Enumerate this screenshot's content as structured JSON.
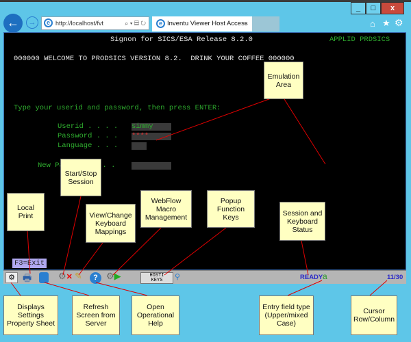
{
  "browser": {
    "address": "http://localhost/fvt",
    "tab_title": "Inventu Viewer Host Access",
    "tab_close": "×",
    "window_buttons": [
      "minimize",
      "maximize",
      "close"
    ]
  },
  "terminal": {
    "header": "Signon for SICS/ESA Release 8.2.0",
    "applid": "APPLID PRDSICS",
    "welcome": "000000 WELCOME TO PRODSICS VERSION 8.2.  DRINK YOUR COFFEE 000000",
    "instruction": "Type your userid and password, then press ENTER:",
    "userid_label": "Userid . . . .",
    "userid_value": "simmy",
    "password_label": "Password . . .",
    "password_value": "****",
    "language_label": "Language . . .",
    "new_password_label": "New Password . . .",
    "f3": "F3=Exit"
  },
  "statusbar": {
    "host_keys_top": "HOSTI",
    "host_keys_bottom": "KEYS",
    "status": "READY",
    "entry_type": "a",
    "cursor": "11/30"
  },
  "callouts": {
    "emulation": "Emulation Area",
    "startstop": "Start/Stop Session",
    "print": "Local Print",
    "keyboard": "View/Change Keyboard Mappings",
    "webflow": "WebFlow Macro Management",
    "popup": "Popup Function Keys",
    "session": "Session and Keyboard Status",
    "settings": "Displays Settings Property Sheet",
    "refresh": "Refresh Screen from Server",
    "help": "Open Operational Help",
    "entry": "Entry field type (Upper/mixed Case)",
    "cursor": "Cursor Row/Column"
  },
  "colors": {
    "terminal_green": "#2fae2f",
    "callout_bg": "#ffffc2",
    "leader_line": "#e00000",
    "status_ready": "#2a2ac8"
  }
}
